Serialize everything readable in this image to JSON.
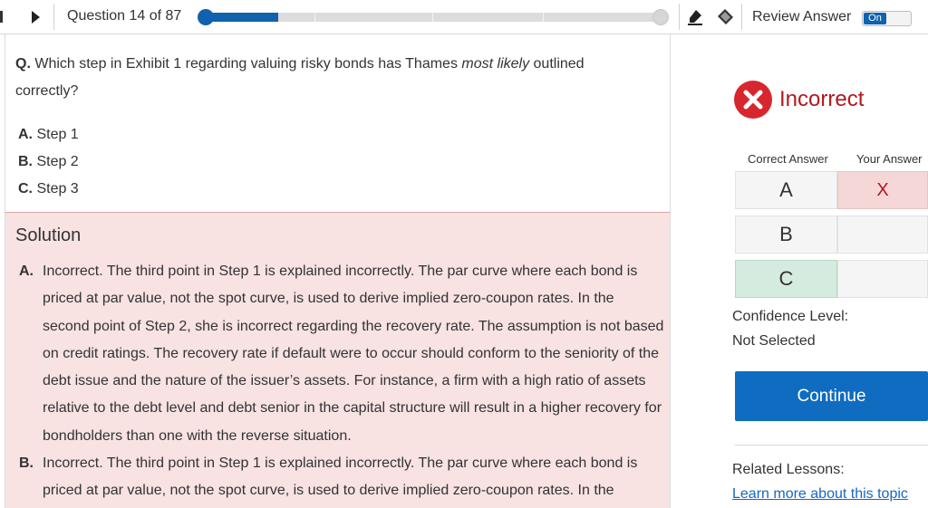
{
  "header": {
    "counter": "Question 14 of 87",
    "progress_fraction": 0.16,
    "review_label": "Review Answer",
    "review_toggle": "On",
    "icons": [
      "play-next-icon",
      "highlighter-icon",
      "eraser-icon"
    ]
  },
  "question": {
    "letter": "Q.",
    "text_before": " Which step in Exhibit 1 regarding valuing risky bonds has Thames ",
    "text_emphasis": "most likely",
    "text_after": " outlined correctly?",
    "options": [
      {
        "letter": "A.",
        "text": " Step 1"
      },
      {
        "letter": "B.",
        "text": " Step 2"
      },
      {
        "letter": "C.",
        "text": " Step 3"
      }
    ]
  },
  "solution": {
    "title": "Solution",
    "items": [
      {
        "letter": "A.",
        "text": "Incorrect. The third point in Step 1 is explained incorrectly. The par curve where each bond is priced at par value, not the spot curve, is used to derive implied zero-coupon rates. In the second point of Step 2, she is incorrect regarding the recovery rate. The assumption is not based on credit ratings. The recovery rate if default were to occur should conform to the seniority of the debt issue and the nature of the issuer’s assets. For instance, a firm with a high ratio of assets relative to the debt level and debt senior in the capital structure will result in a higher recovery for bondholders than one with the reverse situation."
      },
      {
        "letter": "B.",
        "text": "Incorrect. The third point in Step 1 is explained incorrectly. The par curve where each bond is priced at par value, not the spot curve, is used to derive implied zero-coupon rates. In the"
      }
    ]
  },
  "result": {
    "status": "Incorrect",
    "status_color": "#b1181d",
    "correct_header": "Correct Answer",
    "your_header": "Your Answer",
    "rows": [
      {
        "label": "A",
        "your": "X"
      },
      {
        "label": "B",
        "your": ""
      },
      {
        "label": "C",
        "your": ""
      }
    ],
    "confidence_label": "Confidence Level:",
    "confidence_value": "Not Selected",
    "continue_label": "Continue",
    "related_label": "Related Lessons:",
    "related_link": "Learn more about this topic"
  },
  "colors": {
    "accent": "#0f62ad",
    "button": "#0f6cc0",
    "incorrect_bg": "#f8e2e2",
    "correct_cell": "#d6ebe0",
    "wrong_cell": "#f6d7d8",
    "link": "#1667c4"
  }
}
